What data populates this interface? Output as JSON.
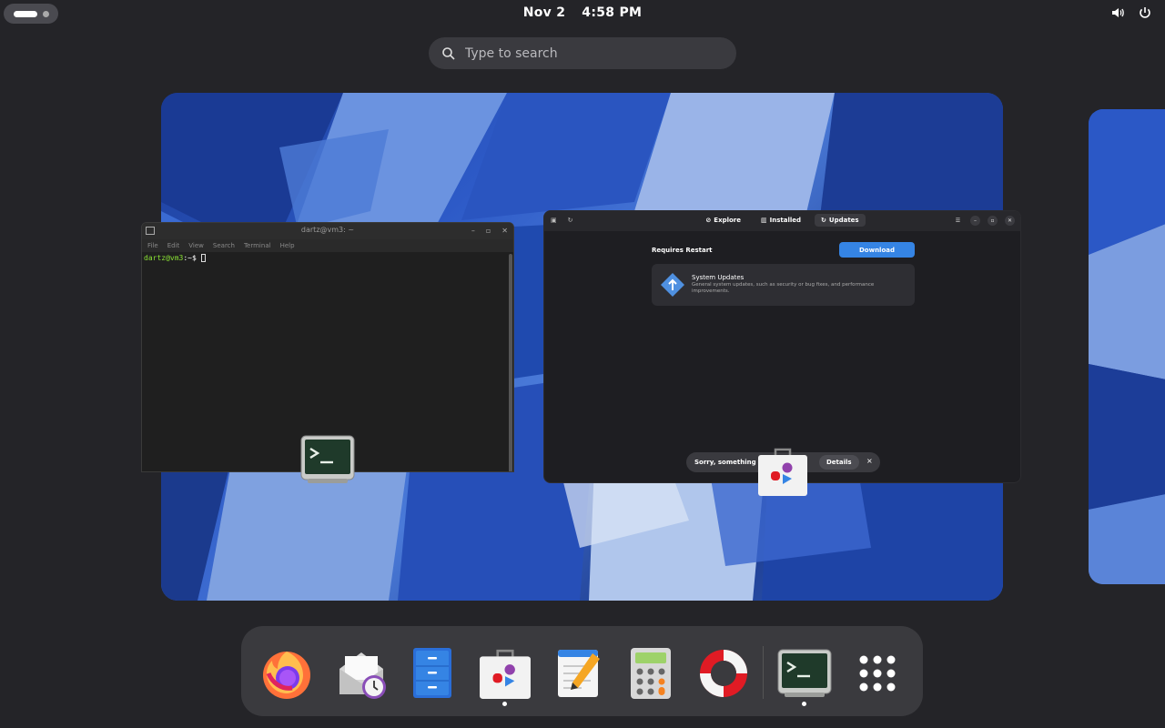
{
  "topbar": {
    "date": "Nov 2",
    "time": "4:58 PM",
    "icons": [
      "volume-icon",
      "power-icon"
    ]
  },
  "search": {
    "placeholder": "Type to search"
  },
  "terminal": {
    "title": "dartz@vm3: ~",
    "menu": [
      "File",
      "Edit",
      "View",
      "Search",
      "Terminal",
      "Help"
    ],
    "prompt_user": "dartz@vm3",
    "prompt_rest": ":~$ "
  },
  "software": {
    "tabs": [
      {
        "label": "Explore",
        "icon": "compass-icon"
      },
      {
        "label": "Installed",
        "icon": "list-icon"
      },
      {
        "label": "Updates",
        "icon": "updates-icon"
      }
    ],
    "section_label": "Requires Restart",
    "download_label": "Download",
    "update_title": "System Updates",
    "update_desc": "General system updates, such as security or bug fixes, and performance improvements.",
    "toast_message": "Sorry, something w",
    "toast_details": "Details",
    "toast_close": "×"
  },
  "dash": {
    "items": [
      {
        "name": "firefox",
        "running": false
      },
      {
        "name": "evolution-mail",
        "running": false
      },
      {
        "name": "files",
        "running": false
      },
      {
        "name": "software",
        "running": true
      },
      {
        "name": "text-editor",
        "running": false
      },
      {
        "name": "calculator",
        "running": false
      },
      {
        "name": "help",
        "running": false
      },
      {
        "name": "terminal",
        "running": true
      },
      {
        "name": "app-grid",
        "running": false
      }
    ]
  },
  "colors": {
    "accent": "#3584e4",
    "panel": "#242428",
    "dash": "#3a3a3e"
  }
}
